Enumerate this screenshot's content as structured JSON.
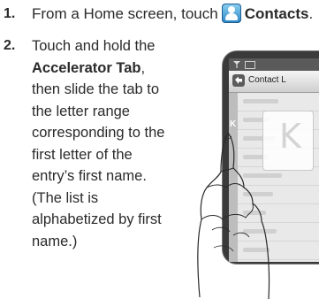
{
  "steps": [
    {
      "number": "1.",
      "text_before": "From a Home screen, touch",
      "bold_text": "Contacts",
      "text_after": ".",
      "icon": "contacts-icon"
    },
    {
      "number": "2.",
      "text_before": "Touch and hold the",
      "bold_text": "Accelerator Tab",
      "text_after": ", then slide the tab to the letter range corresponding to the first letter of the entry’s first name. (The list is alphabetized by first name.)"
    }
  ],
  "illustration": {
    "title": "Contact L",
    "tab_letter": "K",
    "popup_letter": "K",
    "colors": {
      "icon_blue": "#2a86c8",
      "phone_body": "#3a3a3a",
      "screen_bg": "#e9e9e9"
    }
  }
}
